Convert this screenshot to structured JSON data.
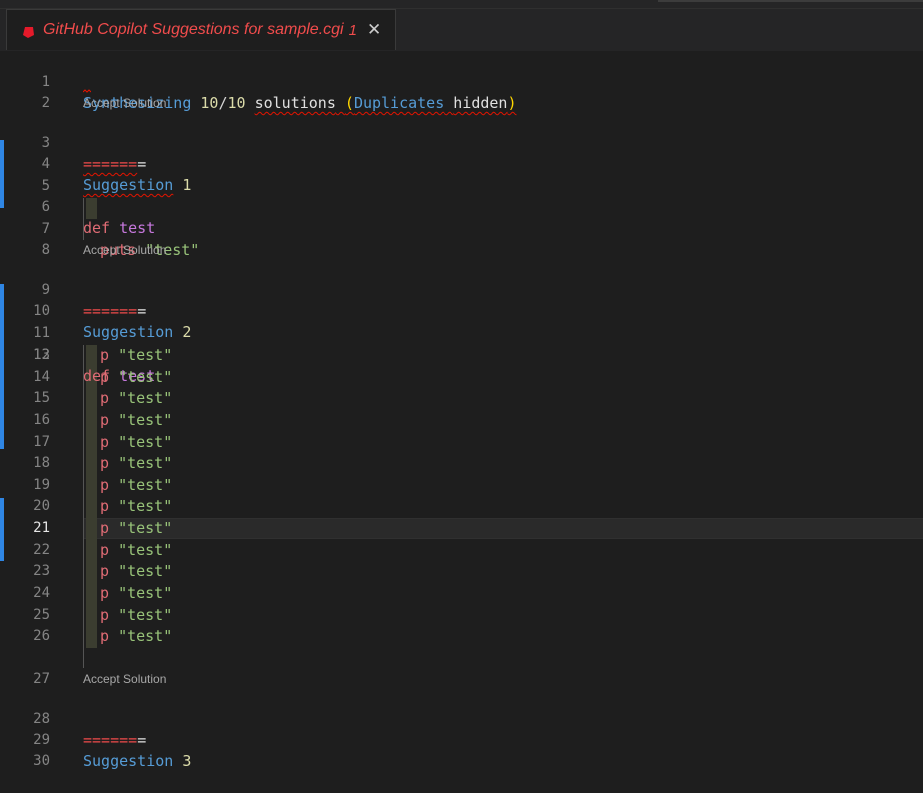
{
  "tab": {
    "title": "GitHub Copilot Suggestions for sample.cgi",
    "problem_count": "1",
    "close_glyph": "✕",
    "icon": "ruby-file-icon"
  },
  "editor": {
    "active_line": "21",
    "header": {
      "line": "1",
      "w1": "Synthesizing",
      "w2": "10",
      "w3": "/",
      "w4": "10",
      "w5": "solutions",
      "w6": "(",
      "w7": "Duplicates",
      "w8": "hidden",
      "w9": ")"
    },
    "line2": "2",
    "lens_label": "Accept Solution",
    "separator": "======",
    "separator_end": "=",
    "suggestion_word": "Suggestion",
    "def_kw": "def",
    "fn_name": "test",
    "s1": {
      "sep_line": "3",
      "title_line": "4",
      "number": "1",
      "blank_line": "5",
      "def_line": "6",
      "body_line": "7",
      "body_call": "puts",
      "body_str": "\"test\"",
      "end_line": "8"
    },
    "s2": {
      "sep_line": "9",
      "title_line": "10",
      "number": "2",
      "blank_line": "11",
      "def_line": "12",
      "body_call": "p",
      "body_str": "\"test\"",
      "body_lines": [
        "13",
        "14",
        "15",
        "16",
        "17",
        "18",
        "19",
        "20",
        "21",
        "22",
        "23",
        "24",
        "25",
        "26"
      ],
      "end_line": "27"
    },
    "s3": {
      "sep_line": "28",
      "title_line": "29",
      "number": "3",
      "next_line": "30"
    }
  }
}
